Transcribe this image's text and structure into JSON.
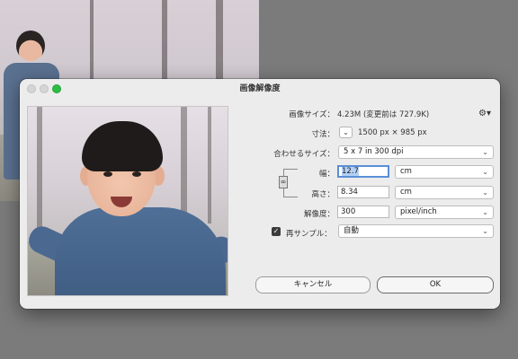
{
  "dialog": {
    "title": "画像解像度",
    "image_size_label": "画像サイズ：",
    "image_size_value": "4.23M (変更前は 727.9K)",
    "dimensions_label": "寸法：",
    "dimensions_value": "1500 px × 985 px",
    "fit_label": "合わせるサイズ：",
    "fit_value": "5 x 7 in 300 dpi",
    "width_label": "幅：",
    "width_value": "12.7",
    "width_unit": "cm",
    "height_label": "高さ：",
    "height_value": "8.34",
    "height_unit": "cm",
    "resolution_label": "解像度：",
    "resolution_value": "300",
    "resolution_unit": "pixel/inch",
    "resample_label": "再サンプル：",
    "resample_value": "自動",
    "resample_checked": true,
    "cancel_label": "キャンセル",
    "ok_label": "OK"
  },
  "icons": {
    "settings": "gear-icon",
    "dimensions_dropdown": "chevron-down-icon",
    "constrain": "link-icon",
    "checkbox": "checkmark-icon"
  },
  "colors": {
    "focus_ring": "#5a8fd8",
    "selection": "#b3d0f5",
    "zoom_traffic_light": "#2dbd45"
  }
}
